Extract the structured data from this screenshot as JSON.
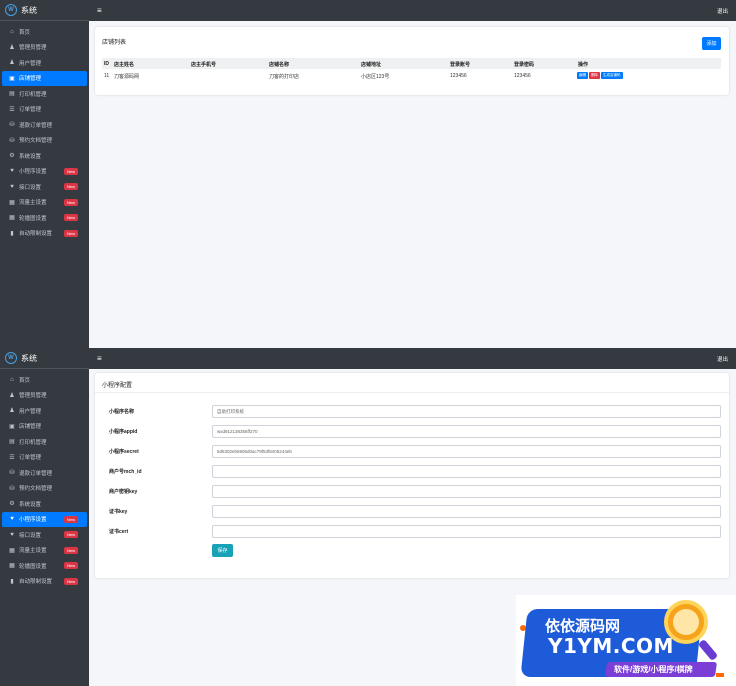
{
  "brand": {
    "title": "系统"
  },
  "topbar": {
    "menu_icon": "≡",
    "logout": "退出"
  },
  "nav_top": [
    {
      "icon": "home-icon",
      "glyph": "⌂",
      "label": "首页",
      "active": false,
      "new": false
    },
    {
      "icon": "user-icon",
      "glyph": "♟",
      "label": "管理员管理",
      "active": false,
      "new": false
    },
    {
      "icon": "user-icon",
      "glyph": "♟",
      "label": "用户管理",
      "active": false,
      "new": false
    },
    {
      "icon": "store-icon",
      "glyph": "▣",
      "label": "店铺管理",
      "active": true,
      "new": false
    },
    {
      "icon": "printer-icon",
      "glyph": "▤",
      "label": "打印机管理",
      "active": false,
      "new": false
    },
    {
      "icon": "list-icon",
      "glyph": "☰",
      "label": "订单管理",
      "active": false,
      "new": false
    },
    {
      "icon": "refund-icon",
      "glyph": "⛁",
      "label": "退款订单管理",
      "active": false,
      "new": false
    },
    {
      "icon": "document-icon",
      "glyph": "⛁",
      "label": "预约文档管理",
      "active": false,
      "new": false
    },
    {
      "icon": "gear-icon",
      "glyph": "⚙",
      "label": "系统设置",
      "active": false,
      "new": false
    },
    {
      "icon": "heart-icon",
      "glyph": "♥",
      "label": "小程序设置",
      "active": false,
      "new": true
    },
    {
      "icon": "heart-icon",
      "glyph": "♥",
      "label": "接口设置",
      "active": false,
      "new": true
    },
    {
      "icon": "image-icon",
      "glyph": "▦",
      "label": "流量主设置",
      "active": false,
      "new": true
    },
    {
      "icon": "image-icon",
      "glyph": "▦",
      "label": "轮播图设置",
      "active": false,
      "new": true
    },
    {
      "icon": "file-icon",
      "glyph": "▮",
      "label": "自动限制设置",
      "active": false,
      "new": true
    }
  ],
  "nav_bot": [
    {
      "icon": "home-icon",
      "glyph": "⌂",
      "label": "首页",
      "active": false,
      "new": false
    },
    {
      "icon": "user-icon",
      "glyph": "♟",
      "label": "管理员管理",
      "active": false,
      "new": false
    },
    {
      "icon": "user-icon",
      "glyph": "♟",
      "label": "用户管理",
      "active": false,
      "new": false
    },
    {
      "icon": "store-icon",
      "glyph": "▣",
      "label": "店铺管理",
      "active": false,
      "new": false
    },
    {
      "icon": "printer-icon",
      "glyph": "▤",
      "label": "打印机管理",
      "active": false,
      "new": false
    },
    {
      "icon": "list-icon",
      "glyph": "☰",
      "label": "订单管理",
      "active": false,
      "new": false
    },
    {
      "icon": "refund-icon",
      "glyph": "⛁",
      "label": "退款订单管理",
      "active": false,
      "new": false
    },
    {
      "icon": "document-icon",
      "glyph": "⛁",
      "label": "预约文档管理",
      "active": false,
      "new": false
    },
    {
      "icon": "gear-icon",
      "glyph": "⚙",
      "label": "系统设置",
      "active": false,
      "new": false
    },
    {
      "icon": "heart-icon",
      "glyph": "♥",
      "label": "小程序设置",
      "active": true,
      "new": true
    },
    {
      "icon": "heart-icon",
      "glyph": "♥",
      "label": "接口设置",
      "active": false,
      "new": true
    },
    {
      "icon": "image-icon",
      "glyph": "▦",
      "label": "流量主设置",
      "active": false,
      "new": true
    },
    {
      "icon": "image-icon",
      "glyph": "▦",
      "label": "轮播图设置",
      "active": false,
      "new": true
    },
    {
      "icon": "file-icon",
      "glyph": "▮",
      "label": "自动限制设置",
      "active": false,
      "new": true
    }
  ],
  "new_badge": "New",
  "store_list": {
    "title": "店铺列表",
    "add_label": "添加",
    "columns": [
      "ID",
      "店主姓名",
      "店主手机号",
      "店铺名称",
      "店铺地址",
      "登录账号",
      "登录密码",
      "操作"
    ],
    "rows": [
      {
        "id": "11",
        "owner": "刀客源码网",
        "phone": "",
        "name": "刀客的打印店",
        "address": "小店区123号",
        "account": "123456",
        "password": "123456"
      }
    ],
    "ops": {
      "edit": "编辑",
      "delete": "删除",
      "qr": "生成店铺码"
    }
  },
  "miniapp": {
    "title": "小程序配置",
    "fields": [
      {
        "label": "小程序名称",
        "value": "自助打印系统"
      },
      {
        "label": "小程序appid",
        "value": "wxd912138356ff270"
      },
      {
        "label": "小程序secret",
        "value": "5d5302eb5906d0ac79f53f8405244eb"
      },
      {
        "label": "商户号mch_id",
        "value": ""
      },
      {
        "label": "商户密钥key",
        "value": ""
      },
      {
        "label": "证书key",
        "value": ""
      },
      {
        "label": "证书cert",
        "value": ""
      }
    ],
    "save_label": "保存"
  },
  "ad": {
    "title_cn": "依依源码网",
    "title_en": "Y1YM.COM",
    "subtitle": "软件/游戏/小程序/棋牌"
  },
  "colors": {
    "sidebar": "#343a40",
    "active": "#007bff",
    "danger": "#dc3545",
    "save": "#17a2b8"
  }
}
